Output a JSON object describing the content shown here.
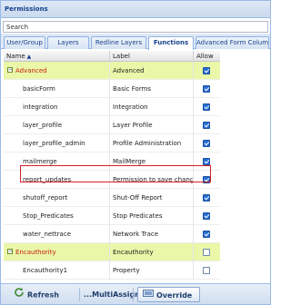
{
  "window": {
    "title": "Permissions"
  },
  "search": {
    "placeholder": "Search"
  },
  "tabs": [
    {
      "label": "User/Group",
      "active": false
    },
    {
      "label": "Layers",
      "active": false
    },
    {
      "label": "Redline Layers",
      "active": false
    },
    {
      "label": "Functions",
      "active": true
    },
    {
      "label": "Advanced Form Columns",
      "active": false
    }
  ],
  "grid": {
    "columns": {
      "name": "Name",
      "label": "Label",
      "allow": "Allow",
      "sort": "ascending"
    },
    "rows": [
      {
        "type": "group",
        "name": "Advanced",
        "label": "Advanced",
        "allow": true,
        "expander": "⊟"
      },
      {
        "type": "item",
        "name": "basicForm",
        "label": "Basic Forms",
        "allow": true
      },
      {
        "type": "item",
        "name": "integration",
        "label": "Integration",
        "allow": true
      },
      {
        "type": "item",
        "name": "layer_profile",
        "label": "Layer Profile",
        "allow": true
      },
      {
        "type": "item",
        "name": "layer_profile_admin",
        "label": "Profile Administration",
        "allow": true
      },
      {
        "type": "item",
        "name": "mailmerge",
        "label": "MailMerge",
        "allow": true
      },
      {
        "type": "item",
        "name": "report_updates",
        "label": "Permission to save changes",
        "allow": true,
        "highlighted": true
      },
      {
        "type": "item",
        "name": "shutoff_report",
        "label": "Shut-Off Report",
        "allow": true
      },
      {
        "type": "item",
        "name": "Stop_Predicates",
        "label": "Stop Predicates",
        "allow": true
      },
      {
        "type": "item",
        "name": "water_nettrace",
        "label": "Network Trace",
        "allow": true
      },
      {
        "type": "group",
        "name": "Encauthority",
        "label": "Encauthority",
        "allow": false,
        "expander": "⊟"
      },
      {
        "type": "item",
        "name": "Encauthority1",
        "label": "Property",
        "allow": false
      }
    ]
  },
  "toolbar": {
    "refresh_label": "Refresh",
    "multiassign_label": "...MultiAssign",
    "override_label": "Override"
  },
  "colors": {
    "header_blue": "#15428b",
    "group_row": "#eaf7a8",
    "group_name_red": "#c41d0f",
    "highlight_border": "#d42027",
    "checkbox_blue": "#2a6fd6"
  }
}
